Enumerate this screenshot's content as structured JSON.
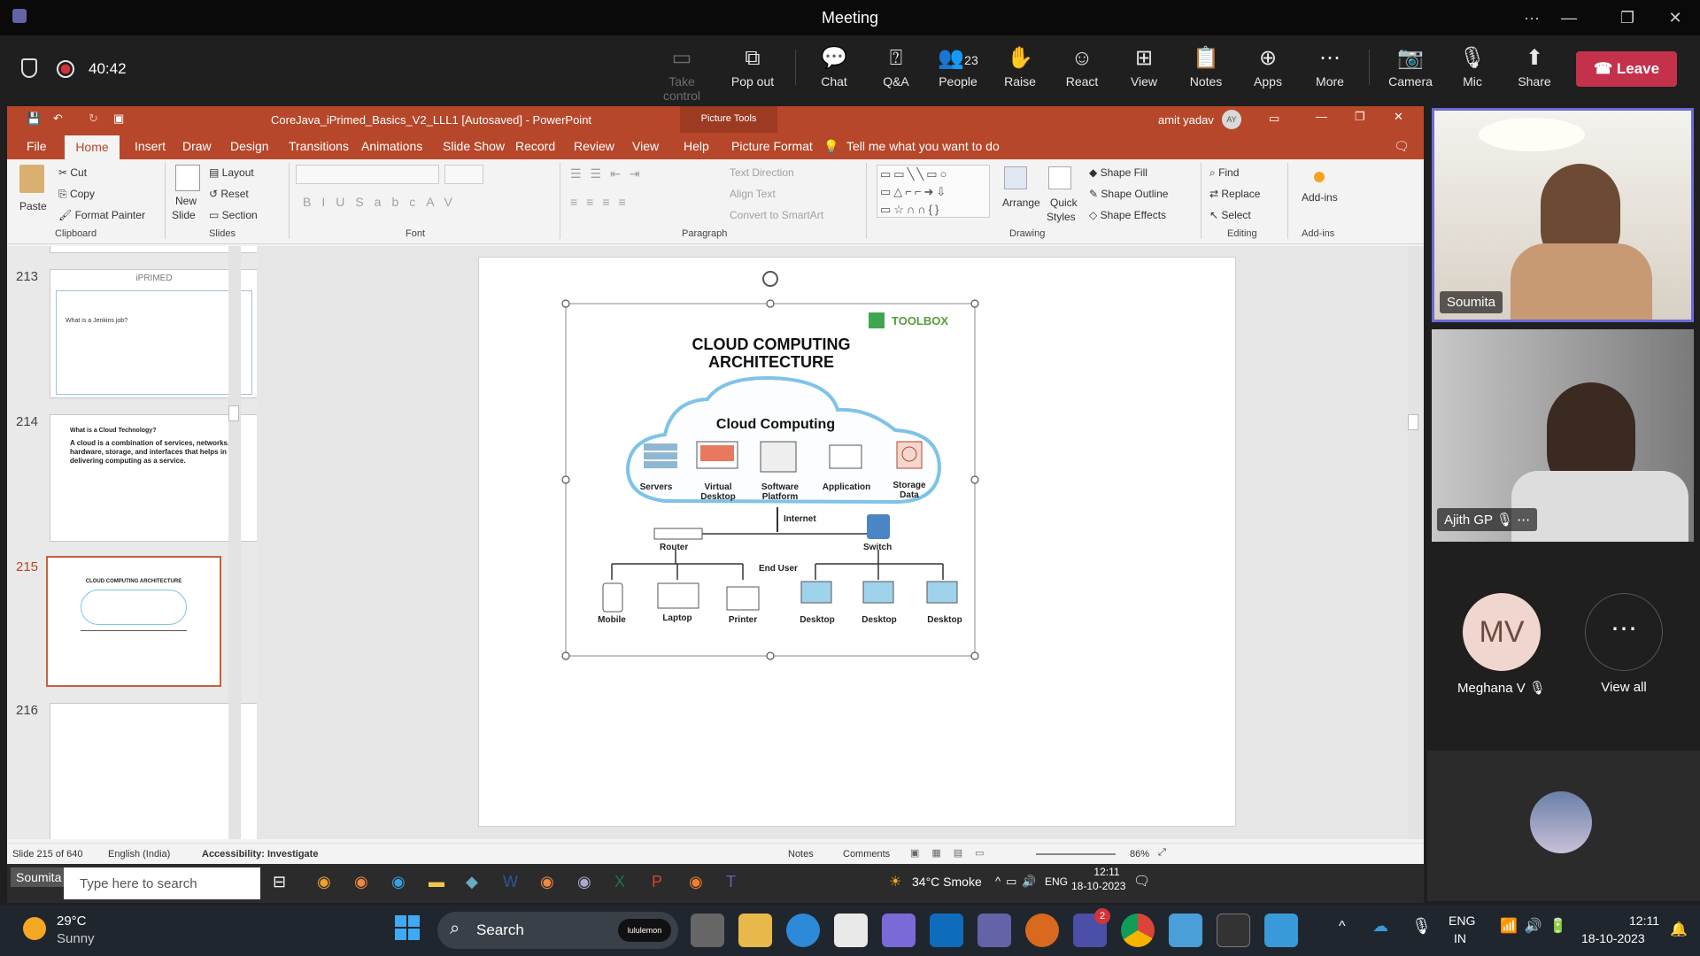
{
  "meeting": {
    "title": "Meeting",
    "timer": "40:42",
    "window_controls": {
      "more": "···",
      "minimize": "—",
      "restore": "❐",
      "close": "✕"
    }
  },
  "toolbar": {
    "take_control": "Take control",
    "pop_out": "Pop out",
    "chat": "Chat",
    "qa": "Q&A",
    "people": "People",
    "people_count": "23",
    "raise": "Raise",
    "react": "React",
    "view": "View",
    "notes": "Notes",
    "apps": "Apps",
    "more": "More",
    "camera": "Camera",
    "mic": "Mic",
    "share": "Share",
    "leave": "Leave"
  },
  "ppt": {
    "doc_title": "CoreJava_iPrimed_Basics_V2_LLL1 [Autosaved]  -  PowerPoint",
    "picture_tools": "Picture Tools",
    "user": "amit yadav",
    "user_initials": "AY",
    "tabs": [
      "File",
      "Home",
      "Insert",
      "Draw",
      "Design",
      "Transitions",
      "Animations",
      "Slide Show",
      "Record",
      "Review",
      "View",
      "Help",
      "Picture Format"
    ],
    "tell_me": "Tell me what you want to do",
    "ribbon": {
      "paste": "Paste",
      "cut": "Cut",
      "copy": "Copy",
      "format_painter": "Format Painter",
      "clipboard": "Clipboard",
      "new_slide": "New",
      "new_slide2": "Slide",
      "layout": "Layout",
      "reset": "Reset",
      "section": "Section",
      "slides": "Slides",
      "font": "Font",
      "paragraph": "Paragraph",
      "text_direction": "Text Direction",
      "align_text": "Align Text",
      "convert_smartart": "Convert to SmartArt",
      "arrange": "Arrange",
      "quick_styles": "Quick",
      "quick_styles2": "Styles",
      "shape_fill": "Shape Fill",
      "shape_outline": "Shape Outline",
      "shape_effects": "Shape Effects",
      "drawing": "Drawing",
      "find": "Find",
      "replace": "Replace",
      "select": "Select",
      "editing": "Editing",
      "add_ins": "Add-ins",
      "add_ins_group": "Add-ins"
    },
    "thumbs": [
      {
        "num": "213",
        "heading": "What is a Jenkins job?",
        "brand": "iPRIMED",
        "selected": false
      },
      {
        "num": "214",
        "heading": "What is a Cloud Technology?",
        "body": "A cloud is a combination of services, networks, hardware, storage, and interfaces that helps in delivering computing as a service.",
        "selected": false
      },
      {
        "num": "215",
        "heading": "CLOUD COMPUTING ARCHITECTURE",
        "selected": true
      },
      {
        "num": "216",
        "selected": false
      }
    ],
    "status": {
      "slide": "Slide 215 of 640",
      "language": "English (India)",
      "accessibility": "Accessibility: Investigate",
      "notes": "Notes",
      "comments": "Comments",
      "zoom": "86%"
    }
  },
  "slide": {
    "brand": "TOOLBOX",
    "title_line1": "CLOUD COMPUTING",
    "title_line2": "ARCHITECTURE",
    "cloud_label": "Cloud Computing",
    "services": [
      {
        "label": "Servers",
        "label2": ""
      },
      {
        "label": "Virtual",
        "label2": "Desktop"
      },
      {
        "label": "Software",
        "label2": "Platform"
      },
      {
        "label": "Application",
        "label2": ""
      },
      {
        "label": "Storage",
        "label2": "Data"
      }
    ],
    "internet": "Internet",
    "router": "Router",
    "switch": "Switch",
    "end_user": "End User",
    "devices": [
      "Mobile",
      "Laptop",
      "Printer",
      "Desktop",
      "Desktop",
      "Desktop"
    ]
  },
  "participants": {
    "p1": "Soumita",
    "p2": "Ajith GP",
    "p3_initials": "MV",
    "p3": "Meghana V",
    "view_all": "View all",
    "overlay_name": "Soumita"
  },
  "inner_taskbar": {
    "search_placeholder": "Type here to search",
    "weather": "34°C  Smoke",
    "lang": "ENG",
    "time": "12:11",
    "date": "18-10-2023"
  },
  "taskbar": {
    "temp": "29°C",
    "weather": "Sunny",
    "search": "Search",
    "search_brand": "lululemon",
    "teams_badge": "2",
    "lang1": "ENG",
    "lang2": "IN",
    "time": "12:11",
    "date": "18-10-2023"
  },
  "colors": {
    "ppt_accent": "#b7472a",
    "leave": "#c4314b",
    "cloud_border": "#7ec3e8",
    "active_speaker": "#6b6bd6"
  }
}
